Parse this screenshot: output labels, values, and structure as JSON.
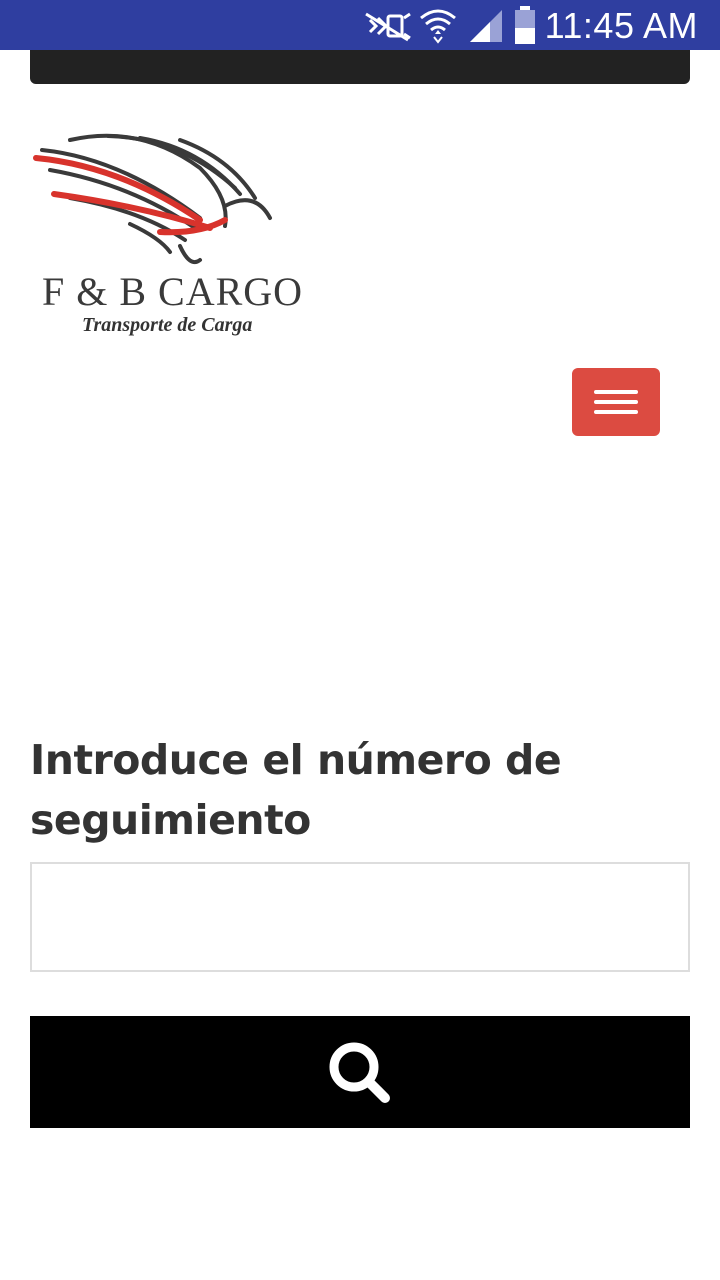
{
  "status_bar": {
    "time": "11:45 AM",
    "icons": [
      "mute-icon",
      "wifi-icon",
      "signal-icon",
      "battery-icon"
    ],
    "background": "#2f3ea0"
  },
  "logo": {
    "title": "F & B CARGO",
    "subtitle": "Transporte de Carga",
    "accent_color": "#d8332c"
  },
  "nav": {
    "menu_icon": "hamburger-icon",
    "menu_color": "#dc4b41"
  },
  "tracking": {
    "heading": "Introduce el número de seguimiento",
    "input_value": "",
    "input_placeholder": "",
    "search_icon": "search-icon"
  }
}
